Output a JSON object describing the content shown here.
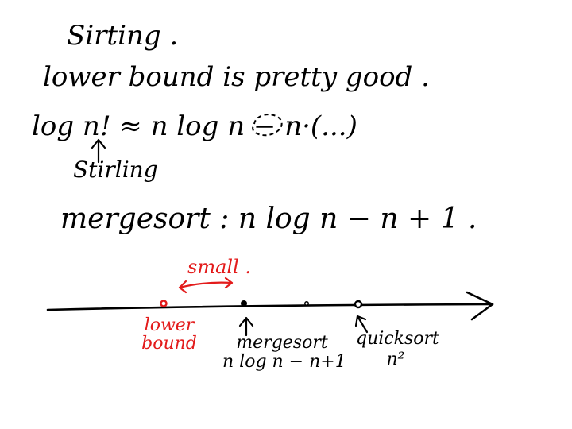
{
  "title": "Sirting .",
  "line_lower_bound": "lower bound is pretty good .",
  "log_approx": {
    "lhs": "log n! ≈",
    "rhs": "n log n − n·(...)"
  },
  "stirling_label": "Stirling",
  "mergesort_line": "mergesort :   n log n − n + 1 .",
  "number_line": {
    "small_label": "small .",
    "lower_bound_label": "lower bound",
    "mergesort_label": "mergesort",
    "mergesort_value": "n log n − n+1",
    "quicksort_label": "quicksort",
    "quicksort_value": "n²"
  },
  "colors": {
    "ink": "#000000",
    "highlight": "#e31b1b"
  }
}
